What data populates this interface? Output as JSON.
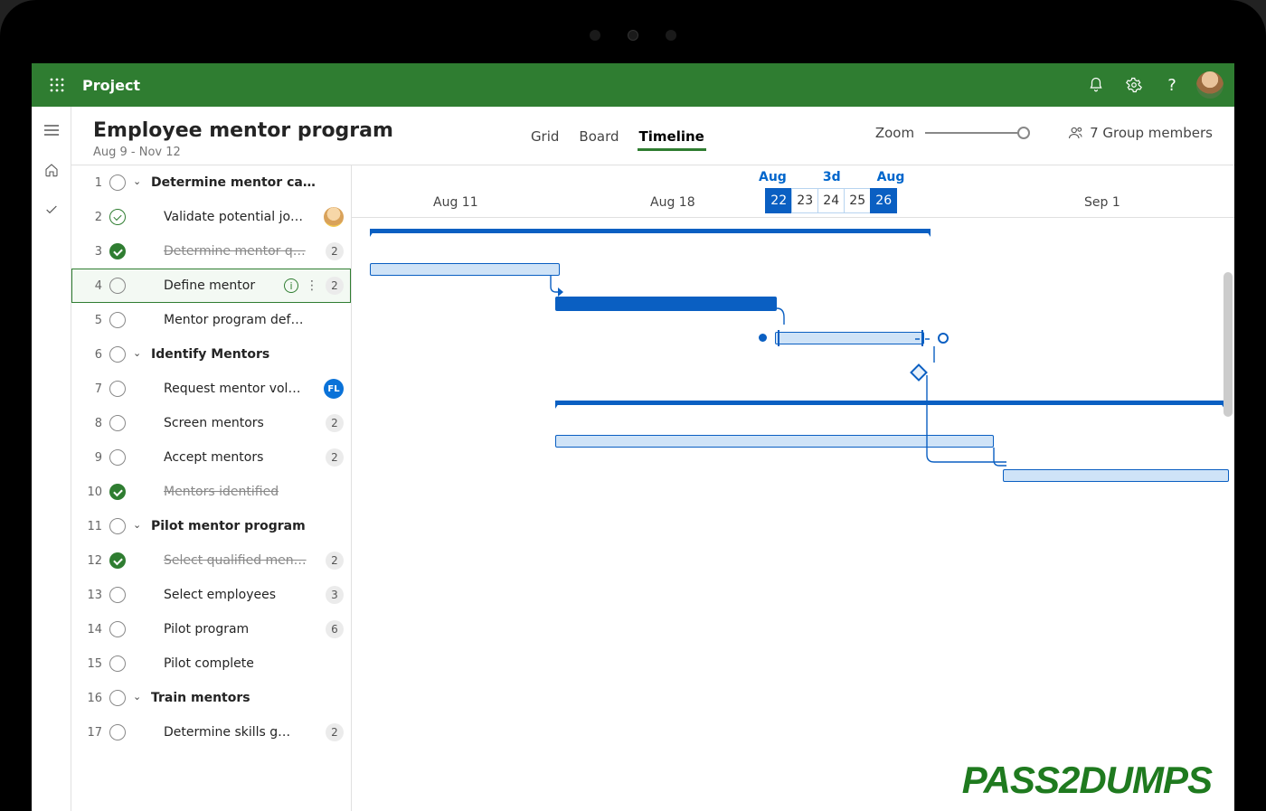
{
  "app": {
    "name": "Project"
  },
  "header": {
    "title": "Employee mentor program",
    "date_range": "Aug 9 - Nov 12",
    "views": {
      "grid": "Grid",
      "board": "Board",
      "timeline": "Timeline"
    },
    "zoom_label": "Zoom",
    "members_label": "7 Group members"
  },
  "timeline_header": {
    "aug11": "Aug 11",
    "aug18": "Aug 18",
    "sep1": "Sep 1",
    "drag_top": {
      "aug_l": "Aug",
      "dur": "3d",
      "aug_r": "Aug"
    },
    "cells": [
      "22",
      "23",
      "24",
      "25",
      "26"
    ]
  },
  "tasks": [
    {
      "num": "1",
      "label": "Determine mentor ca…",
      "bold": true,
      "status": "open",
      "chev": true
    },
    {
      "num": "2",
      "label": "Validate potential jo…",
      "indent": true,
      "status": "check-open",
      "avatar": "img"
    },
    {
      "num": "3",
      "label": "Determine mentor q…",
      "indent": true,
      "status": "check-fill",
      "strike": true,
      "badge": "2"
    },
    {
      "num": "4",
      "label": "Define mentor",
      "indent": true,
      "status": "open",
      "selected": true,
      "info": true,
      "kebab": true,
      "badge": "2"
    },
    {
      "num": "5",
      "label": "Mentor program def…",
      "indent": true,
      "status": "open"
    },
    {
      "num": "6",
      "label": "Identify Mentors",
      "bold": true,
      "status": "open",
      "chev": true
    },
    {
      "num": "7",
      "label": "Request mentor vol…",
      "indent": true,
      "status": "open",
      "avatar": "fl",
      "avatar_text": "FL"
    },
    {
      "num": "8",
      "label": "Screen mentors",
      "indent": true,
      "status": "open",
      "badge": "2"
    },
    {
      "num": "9",
      "label": "Accept mentors",
      "indent": true,
      "status": "open",
      "badge": "2"
    },
    {
      "num": "10",
      "label": "Mentors identified",
      "indent": true,
      "status": "check-fill",
      "strike": true
    },
    {
      "num": "11",
      "label": "Pilot mentor program",
      "bold": true,
      "status": "open",
      "chev": true
    },
    {
      "num": "12",
      "label": "Select qualified men…",
      "indent": true,
      "status": "check-fill",
      "strike": true,
      "badge": "2"
    },
    {
      "num": "13",
      "label": "Select employees",
      "indent": true,
      "status": "open",
      "badge": "3"
    },
    {
      "num": "14",
      "label": "Pilot program",
      "indent": true,
      "status": "open",
      "badge": "6"
    },
    {
      "num": "15",
      "label": "Pilot complete",
      "indent": true,
      "status": "open"
    },
    {
      "num": "16",
      "label": "Train mentors",
      "bold": true,
      "status": "open",
      "chev": true
    },
    {
      "num": "17",
      "label": "Determine skills g…",
      "indent": true,
      "status": "open",
      "badge": "2"
    }
  ],
  "watermark": "PASS2DUMPS"
}
